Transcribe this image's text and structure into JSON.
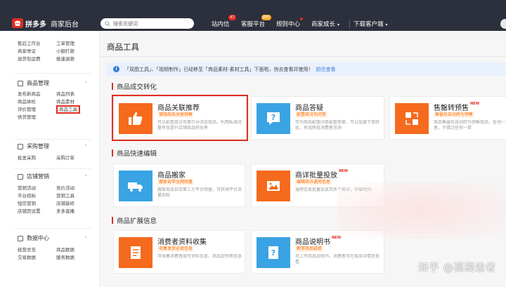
{
  "header": {
    "logo_brand": "拼多多",
    "logo_sub": "商家后台",
    "search_placeholder": "搜索关键词",
    "nav": [
      {
        "label": "站内信",
        "badge": "47"
      },
      {
        "label": "客服平台",
        "badge": "即时"
      },
      {
        "label": "规则中心"
      },
      {
        "label": "商家成长"
      },
      {
        "label": "下载客户端"
      }
    ]
  },
  "sidebar": {
    "top_links": [
      "售后工作台",
      "工单管理",
      "商家举证",
      "小额打款",
      "退货包运费",
      "极速退款"
    ],
    "sections": [
      {
        "title": "商品管理",
        "links": [
          "发布新商品",
          "商品列表",
          "商品体检",
          "商品素材",
          "评价管理",
          "商品工具",
          "供货管理"
        ]
      },
      {
        "title": "采购管理",
        "links": [
          "批发采购",
          "采购订单"
        ]
      },
      {
        "title": "店铺营销",
        "links": [
          "营销活动",
          "竞价活动",
          "平台招标",
          "营销工具",
          "短信营销",
          "店铺装修",
          "店铺页设置",
          "多多直播"
        ]
      },
      {
        "title": "数据中心",
        "links": [
          "经营总览",
          "商品数据",
          "交易数据",
          "服务数据"
        ]
      }
    ]
  },
  "main": {
    "title": "商品工具",
    "notice_text": "「双图工具」、「视频制作」已经移至「商品素材-素材工具」下面啦，快去查看并使用！",
    "notice_link": "前往查看",
    "sections": [
      {
        "title": "商品成交转化",
        "cards": [
          {
            "title": "商品关联推荐",
            "tag": "增强商品关联销售",
            "desc": "可以配置商详页面引导浏览商品，利用私域流量有效提升店铺商品转化率",
            "new": "",
            "color": "#f56a1d"
          },
          {
            "title": "商品答疑",
            "tag": "配置商详页问答",
            "desc": "可为商品配置问答配置答案，可以加速下单转化，有效降低消费者咨询",
            "new": "",
            "color": "#3aa3e3"
          },
          {
            "title": "售罄转预售",
            "tag": "售罄后自动转为预售",
            "desc": "商品售罄后自动转为预售商品，任何一个消费者，不错过任何一单",
            "new": "NEW",
            "color": "#f56a1d"
          }
        ]
      },
      {
        "title": "商品快速编辑",
        "cards": [
          {
            "title": "商品搬家",
            "tag": "搬家自带全网销量",
            "desc": "搬家商品自带第三方平台销量，可获得平台流量加权",
            "new": "",
            "color": "#3aa3e3"
          },
          {
            "title": "商详批量投放",
            "tag": "编辑商详通用信息",
            "desc": "通用信息批量投放到多个商详，节省时间",
            "new": "NEW",
            "color": "#f56a1d"
          }
        ]
      },
      {
        "title": "商品扩展信息",
        "cards": [
          {
            "title": "消费者资料收集",
            "tag": "收集发货必填信息",
            "desc": "可收集消费者填写资料信息，商品定制等信息",
            "new": "",
            "color": "#f56a1d"
          },
          {
            "title": "商品说明书",
            "tag": "解答商品疑惑",
            "desc": "可上传商品说明书，消费者可在商品详情页查看",
            "new": "NEW",
            "color": "#3aa3e3"
          }
        ]
      }
    ]
  },
  "watermark": "知乎 @孤獨患者"
}
